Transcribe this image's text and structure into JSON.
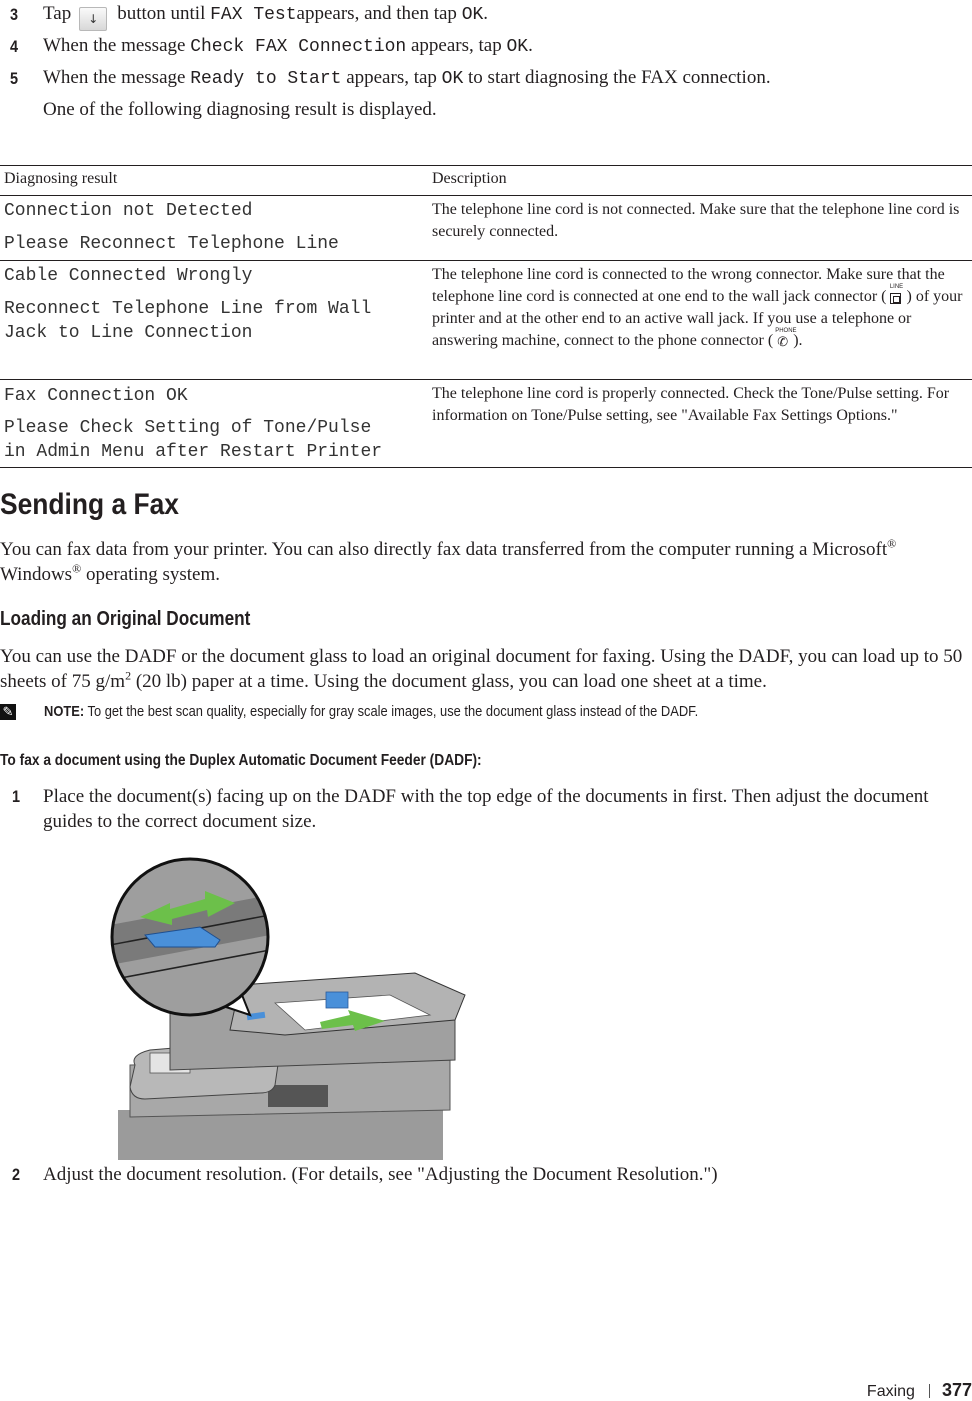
{
  "steps_top": [
    {
      "num": "3",
      "pre": "Tap",
      "button_icon": "down-arrow-icon",
      "button_glyph": "↓",
      "mid": "button until",
      "code1": "FAX Test",
      "post1": "appears, and then tap",
      "code2": "OK",
      "post2": "."
    },
    {
      "num": "4",
      "pre": "When the message",
      "code1": "Check FAX Connection",
      "post1": "appears, tap",
      "code2": "OK",
      "post2": "."
    },
    {
      "num": "5",
      "pre": "When the message",
      "code1": "Ready to Start",
      "post1": "appears, tap",
      "code2": "OK",
      "post2": "to start diagnosing the FAX connection."
    }
  ],
  "intro_after_steps": "One of the following diagnosing result is displayed.",
  "table": {
    "headers": [
      "Diagnosing result",
      "Description"
    ],
    "rows": [
      {
        "result_lines": [
          "Connection not Detected",
          "Please Reconnect Telephone Line"
        ],
        "description": "The telephone line cord is not connected. Make sure that the telephone line cord is securely connected."
      },
      {
        "result_lines": [
          "Cable Connected Wrongly",
          "Reconnect Telephone Line from Wall\nJack to Line Connection"
        ],
        "description_parts": {
          "a": "The telephone line cord is connected to the wrong connector. Make sure that the telephone line cord is connected at one end to the wall jack connector (",
          "line_icon_label": "LINE",
          "b": ") of your printer and at the other end to an active wall jack. If you use a telephone or answering machine, connect to the phone connector (",
          "phone_icon_label": "PHONE",
          "c": ")."
        }
      },
      {
        "result_lines": [
          "Fax Connection OK",
          "Please Check Setting of Tone/Pulse\nin Admin Menu after Restart Printer"
        ],
        "description": "The telephone line cord is properly connected. Check the Tone/Pulse setting. For information on Tone/Pulse setting, see \"Available Fax Settings Options.\""
      }
    ]
  },
  "section": {
    "title": "Sending a Fax",
    "intro_a": "You can fax data from your printer. You can also directly fax data transferred from the computer running a Microsoft",
    "reg": "®",
    "intro_b": " Windows",
    "intro_c": " operating system."
  },
  "subsection": {
    "title": "Loading an Original Document",
    "para_a": "You can use the DADF or the document glass to load an original document for faxing. Using the DADF, you can load up to 50 sheets of 75 g/m",
    "para_sup": "2",
    "para_b": " (20 lb) paper at a time. Using the document glass, you can load one sheet at a time.",
    "note_label": "NOTE:",
    "note_text": " To get the best scan quality, especially for gray scale images, use the document glass instead of the DADF."
  },
  "procedure": {
    "title": "To fax a document using the Duplex Automatic Document Feeder (DADF):",
    "steps": [
      {
        "num": "1",
        "text": "Place the document(s) facing up on the DADF with the top edge of the documents in first. Then adjust the document guides to the correct document size."
      },
      {
        "num": "2",
        "text": "Adjust the document resolution. (For details, see \"Adjusting the Document Resolution.\")"
      }
    ]
  },
  "figure": {
    "alt": "Printer DADF with document guide being adjusted",
    "colors": {
      "guide": "#4a90d9",
      "arrow": "#6cc04a",
      "body": "#8a8a8a"
    }
  },
  "footer": {
    "chapter": "Faxing",
    "page": "377"
  }
}
